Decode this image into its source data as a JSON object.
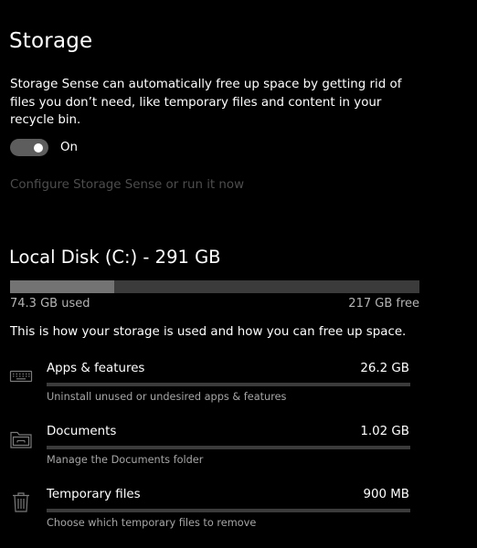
{
  "page": {
    "title": "Storage"
  },
  "storage_sense": {
    "description": "Storage Sense can automatically free up space by getting rid of files you don’t need, like temporary files and content in your recycle bin.",
    "toggle_state": "On",
    "toggle_on": true,
    "configure_link": "Configure Storage Sense or run it now"
  },
  "disk": {
    "title": "Local Disk (C:) - 291 GB",
    "used_label": "74.3 GB used",
    "free_label": "217 GB free",
    "used_fraction": 0.255
  },
  "usage": {
    "description": "This is how your storage is used and how you can free up space.",
    "categories": [
      {
        "name": "Apps & features",
        "size": "26.2 GB",
        "subtitle": "Uninstall unused or undesired apps & features",
        "icon": "keyboard-icon",
        "fraction": 0.0
      },
      {
        "name": "Documents",
        "size": "1.02 GB",
        "subtitle": "Manage the Documents folder",
        "icon": "folder-icon",
        "fraction": 0.0
      },
      {
        "name": "Temporary files",
        "size": "900 MB",
        "subtitle": "Choose which temporary files to remove",
        "icon": "trash-icon",
        "fraction": 0.0
      }
    ]
  },
  "colors": {
    "background": "#000000",
    "text": "#ffffff",
    "muted_text": "#a6a6a6",
    "disabled_link": "#4d4d4d",
    "bar_track": "#3b3b3b",
    "bar_fill": "#737373",
    "toggle_track": "#5d5d5d"
  }
}
